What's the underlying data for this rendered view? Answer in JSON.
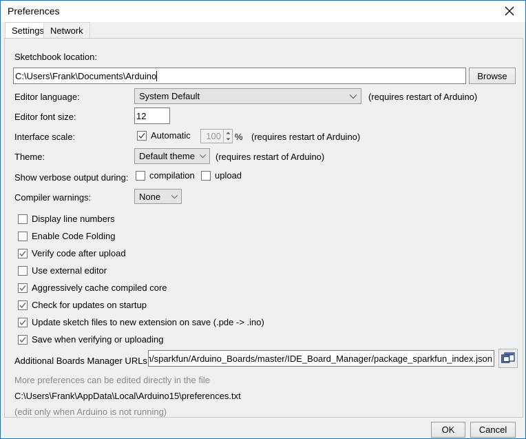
{
  "window": {
    "title": "Preferences",
    "accent_color": "#0078d7",
    "panel_bg": "#f0f0f0",
    "close_icon": "close-icon"
  },
  "tabs": [
    {
      "label": "Settings",
      "selected": true
    },
    {
      "label": "Network",
      "selected": false
    }
  ],
  "settings": {
    "sketchbook": {
      "label": "Sketchbook location:",
      "value": "C:\\Users\\Frank\\Documents\\Arduino",
      "browse_label": "Browse"
    },
    "editor_language": {
      "label": "Editor language:",
      "value": "System Default",
      "note": "(requires restart of Arduino)"
    },
    "editor_font_size": {
      "label": "Editor font size:",
      "value": "12"
    },
    "interface_scale": {
      "label": "Interface scale:",
      "automatic_label": "Automatic",
      "automatic_checked": true,
      "scale_value": "100",
      "percent_symbol": "%",
      "note": "(requires restart of Arduino)"
    },
    "theme": {
      "label": "Theme:",
      "value": "Default theme",
      "note": "(requires restart of Arduino)"
    },
    "verbose_output": {
      "label": "Show verbose output during:",
      "compilation_label": "compilation",
      "compilation_checked": false,
      "upload_label": "upload",
      "upload_checked": false
    },
    "compiler_warnings": {
      "label": "Compiler warnings:",
      "value": "None"
    },
    "checkboxes": [
      {
        "label": "Display line numbers",
        "checked": false
      },
      {
        "label": "Enable Code Folding",
        "checked": false
      },
      {
        "label": "Verify code after upload",
        "checked": true
      },
      {
        "label": "Use external editor",
        "checked": false
      },
      {
        "label": "Aggressively cache compiled core",
        "checked": true
      },
      {
        "label": "Check for updates on startup",
        "checked": true
      },
      {
        "label": "Update sketch files to new extension on save (.pde -> .ino)",
        "checked": true
      },
      {
        "label": "Save when verifying or uploading",
        "checked": true
      }
    ],
    "boards_urls": {
      "label": "Additional Boards Manager URLs:",
      "value": "n/sparkfun/Arduino_Boards/master/IDE_Board_Manager/package_sparkfun_index.json",
      "expand_icon": "windows-expand-icon"
    },
    "footnotes": {
      "line1": "More preferences can be edited directly in the file",
      "line2": "C:\\Users\\Frank\\AppData\\Local\\Arduino15\\preferences.txt",
      "line3": "(edit only when Arduino is not running)"
    }
  },
  "footer": {
    "ok_label": "OK",
    "cancel_label": "Cancel"
  }
}
